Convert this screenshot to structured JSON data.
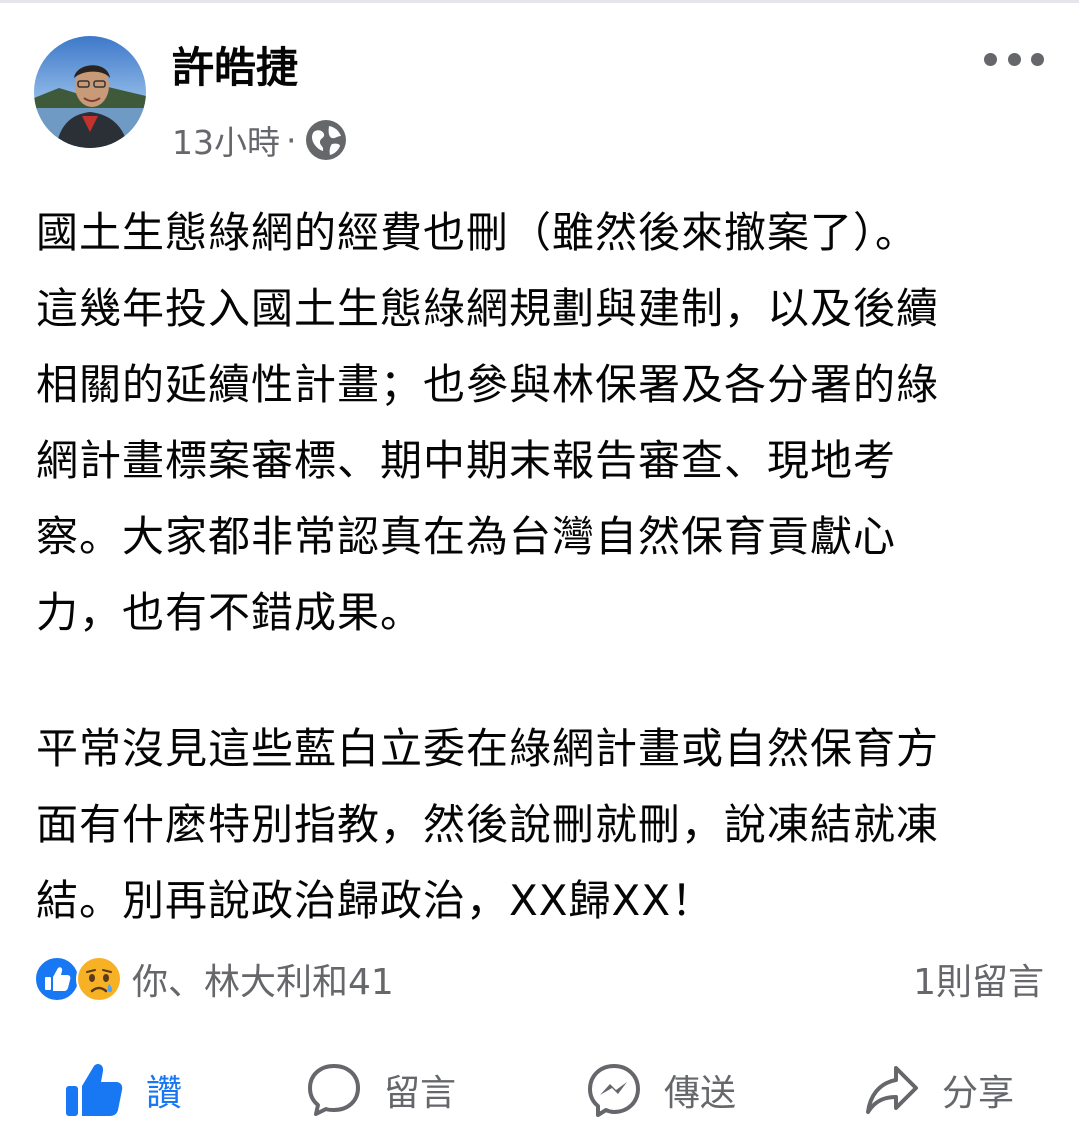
{
  "post": {
    "author": "許皓捷",
    "time": "13小時",
    "separator": "·",
    "visibility_icon": "globe-icon",
    "more_icon": "more-horizontal-icon",
    "paragraphs": [
      [
        "國土生態綠網的經費也刪（雖然後來撤案了）。",
        "這幾年投入國土生態綠網規劃與建制，以及後續",
        "相關的延續性計畫；也參與林保署及各分署的綠",
        "網計畫標案審標、期中期末報告審查、現地考",
        "察。大家都非常認真在為台灣自然保育貢獻心",
        "力，也有不錯成果。"
      ],
      [
        "平常沒見這些藍白立委在綠網計畫或自然保育方",
        "面有什麼特別指教，然後說刪就刪，說凍結就凍",
        "結。別再說政治歸政治，XX歸XX！"
      ]
    ]
  },
  "reactions": {
    "icons": [
      "like-reaction-icon",
      "sad-reaction-icon"
    ],
    "summary": "你、林大利和41",
    "comments": "1則留言"
  },
  "actions": {
    "like": "讚",
    "comment": "留言",
    "send": "傳送",
    "share": "分享"
  },
  "colors": {
    "accent": "#1877f2",
    "secondary_text": "#65676b",
    "text": "#050505"
  }
}
